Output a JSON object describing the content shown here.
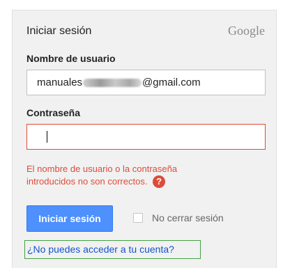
{
  "header": {
    "title": "Iniciar sesión",
    "logo_text": "Google"
  },
  "form": {
    "username_label": "Nombre de usuario",
    "username_prefix": "manuales",
    "username_suffix": "@gmail.com",
    "password_label": "Contraseña",
    "password_value": "",
    "error_line1": "El nombre de usuario o la contraseña",
    "error_line2": "introducidos no son correctos.",
    "help_icon_glyph": "?",
    "signin_button": "Iniciar sesión",
    "stay_signed_in": "No cerrar sesión",
    "stay_signed_in_checked": false,
    "cant_access_link": "¿No puedes acceder a tu cuenta?"
  },
  "colors": {
    "card_bg": "#f1f1f1",
    "button_blue": "#4d90fe",
    "error_red": "#dd4b39",
    "link_blue": "#1155cc",
    "focus_green": "#43a143"
  },
  "icons": {
    "help": "help-question-icon",
    "caret": "text-cursor"
  }
}
